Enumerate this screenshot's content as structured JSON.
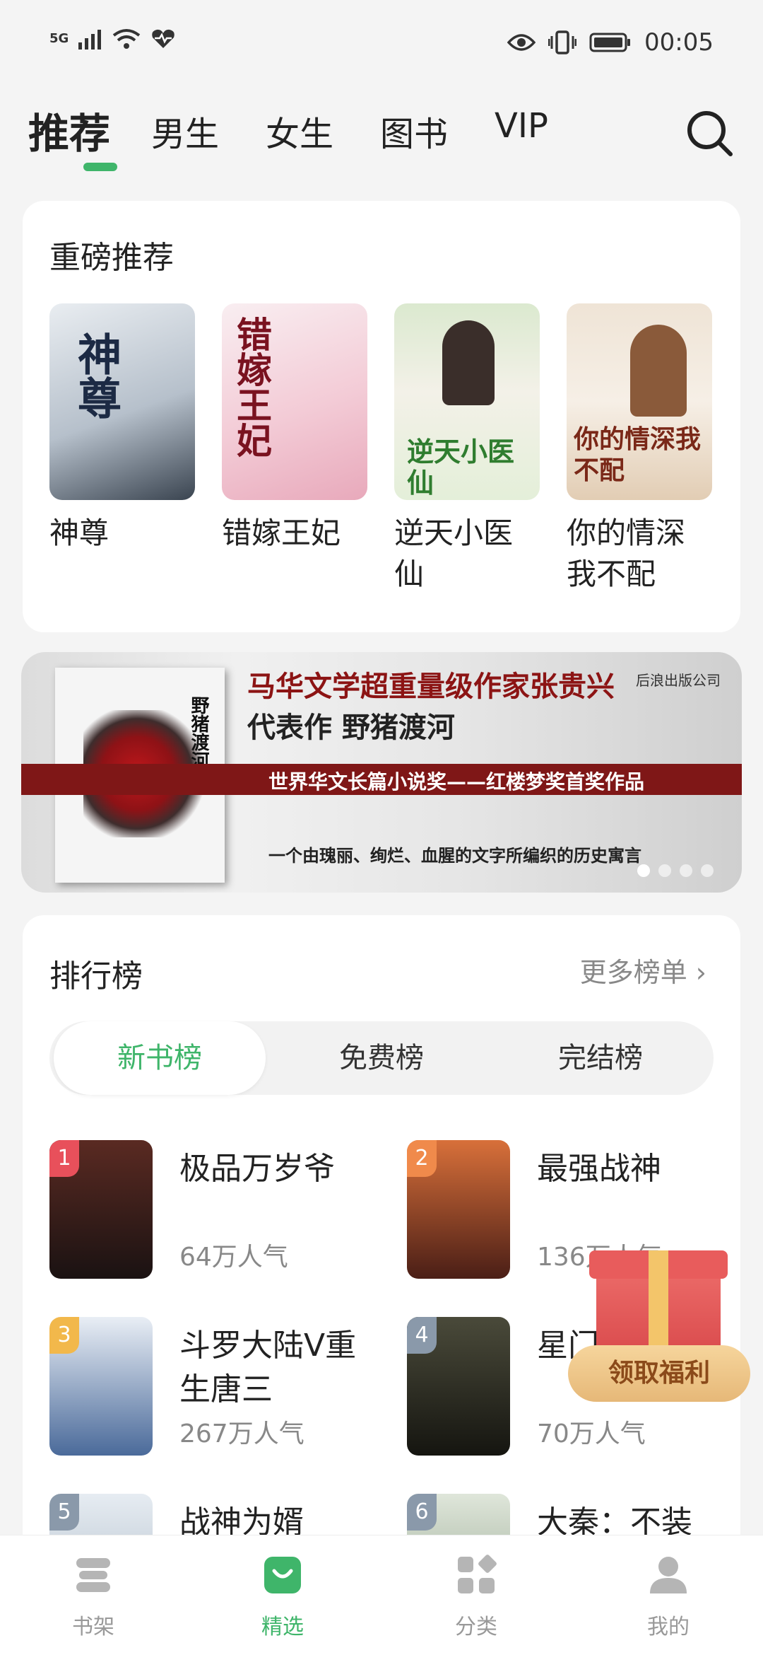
{
  "status_bar": {
    "network": "5G",
    "time": "00:05"
  },
  "top_tabs": [
    {
      "label": "推荐",
      "active": true
    },
    {
      "label": "男生",
      "active": false
    },
    {
      "label": "女生",
      "active": false
    },
    {
      "label": "图书",
      "active": false
    },
    {
      "label": "VIP",
      "active": false
    }
  ],
  "featured": {
    "title": "重磅推荐",
    "books": [
      {
        "title": "神尊",
        "cover_text": "神尊"
      },
      {
        "title": "错嫁王妃",
        "cover_text": "错嫁王妃"
      },
      {
        "title": "逆天小医仙",
        "cover_text": "逆天小医仙"
      },
      {
        "title": "你的情深我不配",
        "cover_text": "你的情深我不配"
      }
    ]
  },
  "banner": {
    "headline": "马华文学超重量级作家张贵兴",
    "subline": "代表作 野猪渡河",
    "award": "世界华文长篇小说奖——红楼梦奖首奖作品",
    "tagline": "一个由瑰丽、绚烂、血腥的文字所编织的历史寓言",
    "book_title": "野猪渡河",
    "publisher": "后浪出版公司"
  },
  "ranking": {
    "title": "排行榜",
    "more_label": "更多榜单 ›",
    "segments": [
      {
        "label": "新书榜",
        "active": true
      },
      {
        "label": "免费榜",
        "active": false
      },
      {
        "label": "完结榜",
        "active": false
      }
    ],
    "items": [
      {
        "rank": "1",
        "title": "极品万岁爷",
        "popularity": "64万人气",
        "badge_color": "#e8505b",
        "cover_color": "#2a1c1a"
      },
      {
        "rank": "2",
        "title": "最强战神",
        "popularity": "136万人气",
        "badge_color": "#f08a4b",
        "cover_color": "#6b2a22"
      },
      {
        "rank": "3",
        "title": "斗罗大陆V重生唐三",
        "popularity": "267万人气",
        "badge_color": "#f2b84b",
        "cover_color": "#3f5a8a"
      },
      {
        "rank": "4",
        "title": "星门",
        "popularity": "70万人气",
        "badge_color": "#8a99aa",
        "cover_color": "#2f3b2a"
      },
      {
        "rank": "5",
        "title": "战神为婿",
        "popularity": "",
        "badge_color": "#8a99aa",
        "cover_color": "#c9d4de"
      },
      {
        "rank": "6",
        "title": "大秦：不装",
        "popularity": "",
        "badge_color": "#8a99aa",
        "cover_color": "#b7c4b0"
      }
    ]
  },
  "gift_button": {
    "label": "领取福利"
  },
  "bottom_nav": [
    {
      "label": "书架",
      "active": false
    },
    {
      "label": "精选",
      "active": true
    },
    {
      "label": "分类",
      "active": false
    },
    {
      "label": "我的",
      "active": false
    }
  ],
  "colors": {
    "accent": "#3fb56a",
    "muted": "#999999"
  }
}
